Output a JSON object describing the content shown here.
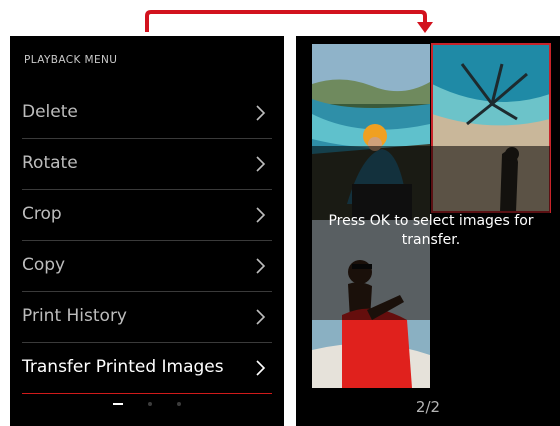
{
  "menu": {
    "title": "PLAYBACK MENU",
    "items": [
      {
        "label": "Delete"
      },
      {
        "label": "Rotate"
      },
      {
        "label": "Crop"
      },
      {
        "label": "Copy"
      },
      {
        "label": "Print History"
      },
      {
        "label": "Transfer Printed Images",
        "selected": true
      }
    ],
    "pages": {
      "count": 3,
      "active": 1
    }
  },
  "preview": {
    "instruction": "Press OK to select images for transfer.",
    "page_counter": "2/2"
  },
  "colors": {
    "accent": "#d2121e",
    "background": "#000000"
  }
}
